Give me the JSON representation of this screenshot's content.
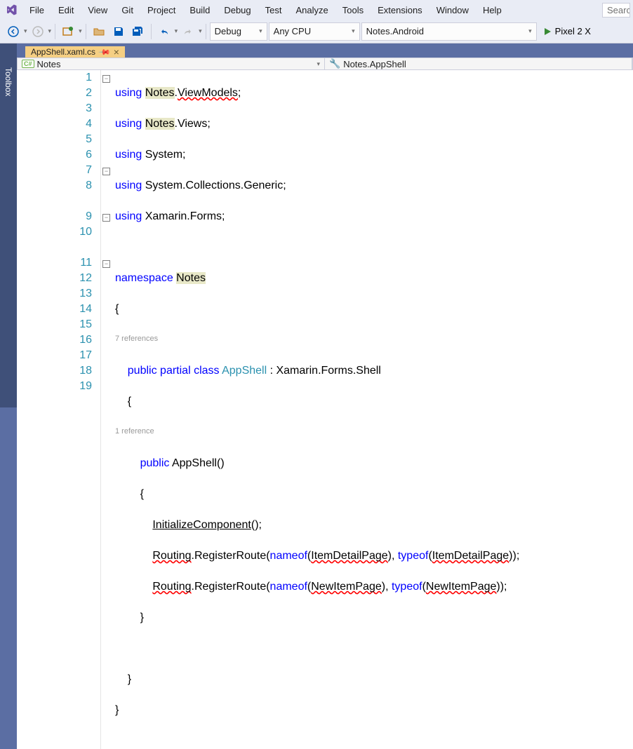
{
  "menu": {
    "file": "File",
    "edit": "Edit",
    "view": "View",
    "git": "Git",
    "project": "Project",
    "build": "Build",
    "debug": "Debug",
    "test": "Test",
    "analyze": "Analyze",
    "tools": "Tools",
    "extensions": "Extensions",
    "window": "Window",
    "help": "Help"
  },
  "search_placeholder": "Search",
  "toolbar_dd": {
    "config": "Debug",
    "platform": "Any CPU",
    "target": "Notes.Android",
    "device": "Pixel 2 X"
  },
  "toolbox_label": "Toolbox",
  "tab": {
    "name": "AppShell.xaml.cs"
  },
  "nav": {
    "left": "Notes",
    "right": "Notes.AppShell"
  },
  "codelens": {
    "class_refs": "7 references",
    "ctor_refs": "1 reference"
  },
  "code": {
    "l1": {
      "a": "using",
      "ns": "Notes",
      "dot": ".",
      "t": "ViewModels",
      "end": ";"
    },
    "l2": {
      "a": "using",
      "ns": "Notes",
      "dot": ".",
      "t": "Views",
      "end": ";"
    },
    "l3": {
      "a": "using",
      "t": " System;"
    },
    "l4": {
      "a": "using",
      "t": " System.Collections.Generic;"
    },
    "l5": {
      "a": "using",
      "t": " Xamarin.Forms;"
    },
    "l7": {
      "a": "namespace",
      "ns": "Notes"
    },
    "l8": "{",
    "l9": {
      "a": "public",
      "b": "partial",
      "c": "class",
      "t": "AppShell",
      "colon": " : ",
      "base": "Xamarin.Forms.Shell"
    },
    "l10": "{",
    "l11": {
      "a": "public",
      "t": "AppShell",
      "p": "()"
    },
    "l12": "{",
    "l13": {
      "m": "InitializeComponent",
      "p": "();"
    },
    "l14": {
      "r": "Routing",
      "m": ".RegisterRoute(",
      "n": "nameof",
      "p1": "(",
      "a1": "ItemDetailPage",
      "p2": "), ",
      "t": "typeof",
      "p3": "(",
      "a2": "ItemDetailPage",
      "p4": "));"
    },
    "l15": {
      "r": "Routing",
      "m": ".RegisterRoute(",
      "n": "nameof",
      "p1": "(",
      "a1": "NewItemPage",
      "p2": "), ",
      "t": "typeof",
      "p3": "(",
      "a2": "NewItemPage",
      "p4": "));"
    },
    "l16": "}",
    "l18": "}",
    "l19": "}"
  },
  "line_numbers": [
    "1",
    "2",
    "3",
    "4",
    "5",
    "6",
    "7",
    "8",
    "",
    "9",
    "10",
    "",
    "11",
    "12",
    "13",
    "14",
    "15",
    "16",
    "17",
    "18",
    "19"
  ]
}
